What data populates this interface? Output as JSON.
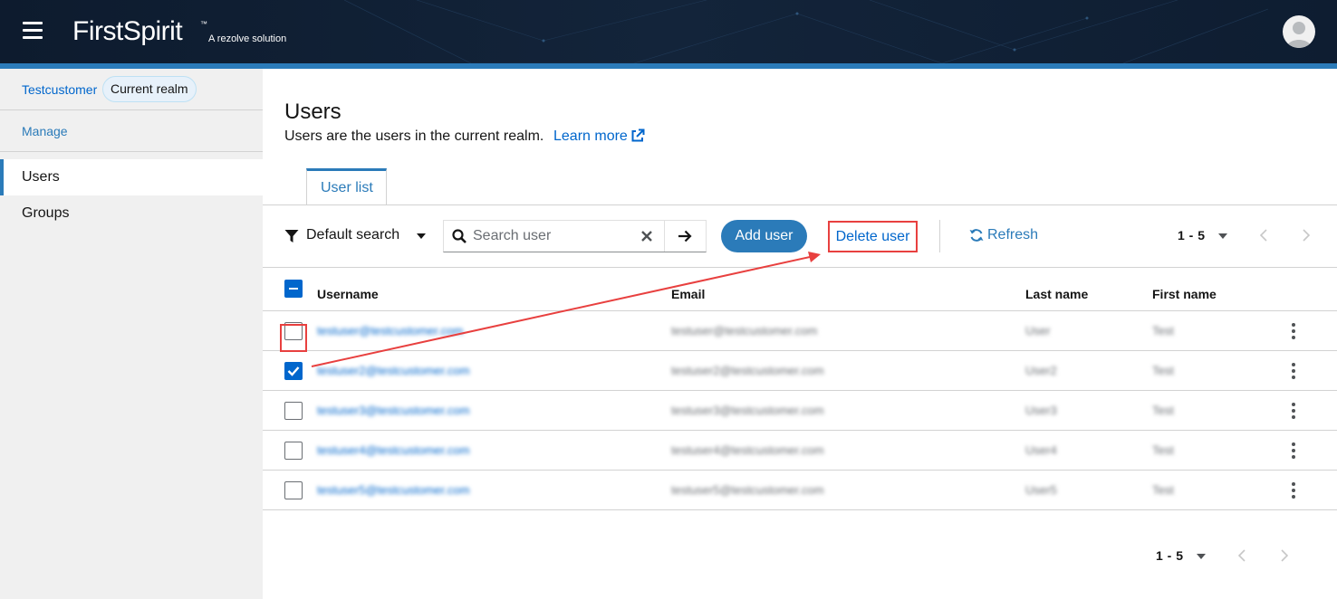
{
  "header": {
    "brand": "FirstSpirit",
    "brand_tm": "™",
    "brand_sub": "A rezolve solution",
    "menu_icon": "hamburger-menu-icon",
    "avatar_icon": "user-avatar-icon",
    "bg_color": "#0d1b2e",
    "stripe_color": "#2b7bb9"
  },
  "sidebar": {
    "realm_name": "Testcustomer",
    "realm_badge": "Current realm",
    "section_label": "Manage",
    "items": [
      {
        "label": "Users",
        "active": true
      },
      {
        "label": "Groups",
        "active": false
      }
    ]
  },
  "page": {
    "title": "Users",
    "description": "Users are the users in the current realm.",
    "learn_more": "Learn more",
    "tabs": [
      {
        "label": "User list",
        "active": true
      }
    ]
  },
  "toolbar": {
    "filter_label": "Default search",
    "search_placeholder": "Search user",
    "add_user_label": "Add user",
    "delete_user_label": "Delete user",
    "refresh_label": "Refresh",
    "pager_range": "1 - 5"
  },
  "table": {
    "columns": [
      "Username",
      "Email",
      "Last name",
      "First name"
    ],
    "rows": [
      {
        "username": "testuser@testcustomer.com",
        "email": "testuser@testcustomer.com",
        "last_name": "User",
        "first_name": "Test",
        "selected": false
      },
      {
        "username": "testuser2@testcustomer.com",
        "email": "testuser2@testcustomer.com",
        "last_name": "User2",
        "first_name": "Test",
        "selected": true
      },
      {
        "username": "testuser3@testcustomer.com",
        "email": "testuser3@testcustomer.com",
        "last_name": "User3",
        "first_name": "Test",
        "selected": false
      },
      {
        "username": "testuser4@testcustomer.com",
        "email": "testuser4@testcustomer.com",
        "last_name": "User4",
        "first_name": "Test",
        "selected": false
      },
      {
        "username": "testuser5@testcustomer.com",
        "email": "testuser5@testcustomer.com",
        "last_name": "User5",
        "first_name": "Test",
        "selected": false
      }
    ]
  },
  "footer_pager": {
    "range": "1 - 5"
  },
  "annotation_color": "#e8403f"
}
